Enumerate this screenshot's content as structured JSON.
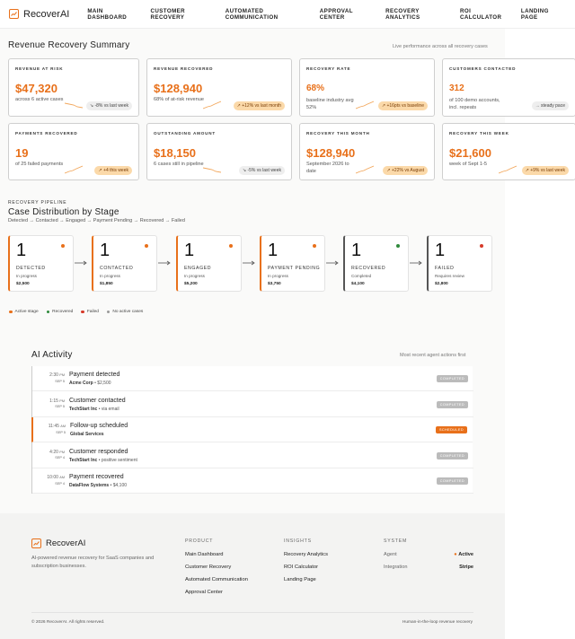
{
  "nav": {
    "brand": "RecoverAI",
    "links": [
      "MAIN DASHBOARD",
      "CUSTOMER RECOVERY",
      "AUTOMATED COMMUNICATION",
      "APPROVAL CENTER",
      "RECOVERY ANALYTICS",
      "ROI CALCULATOR",
      "LANDING PAGE"
    ]
  },
  "summary": {
    "title": "Revenue Recovery Summary",
    "note": "Live performance across all recovery cases",
    "cards": [
      {
        "label": "REVENUE AT RISK",
        "value": "$47,320",
        "desc": "across 6 active cases",
        "trend": "↘ -8% vs last week",
        "trend_dir": "down"
      },
      {
        "label": "REVENUE RECOVERED",
        "value": "$128,940",
        "desc": "68% of at-risk revenue",
        "trend": "↗ +12% vs last month",
        "trend_dir": "up"
      },
      {
        "label": "RECOVERY RATE",
        "value": "68%",
        "desc": "baseline industry avg 52%",
        "trend": "↗ +16pts vs baseline",
        "trend_dir": "up"
      },
      {
        "label": "CUSTOMERS CONTACTED",
        "value": "312",
        "desc": "of 100 demo accounts, incl. repeats",
        "trend": "→ steady pace",
        "trend_dir": "flat"
      },
      {
        "label": "PAYMENTS RECOVERED",
        "value": "19",
        "desc": "of 25 failed payments",
        "trend": "↗ +4 this week",
        "trend_dir": "up"
      },
      {
        "label": "OUTSTANDING AMOUNT",
        "value": "$18,150",
        "desc": "6 cases still in pipeline",
        "trend": "↘ -5% vs last week",
        "trend_dir": "down"
      },
      {
        "label": "RECOVERY THIS MONTH",
        "value": "$128,940",
        "desc": "September 2026 to date",
        "trend": "↗ +22% vs August",
        "trend_dir": "up"
      },
      {
        "label": "RECOVERY THIS WEEK",
        "value": "$21,600",
        "desc": "week of Sept 1-5",
        "trend": "↗ +9% vs last week",
        "trend_dir": "up"
      }
    ]
  },
  "pipeline": {
    "eyebrow": "RECOVERY PIPELINE",
    "title": "Case Distribution by Stage",
    "flow": "Detected → Contacted → Engaged → Payment Pending → Recovered → Failed",
    "stages": [
      {
        "count": "1",
        "name": "DETECTED",
        "status": "In progress",
        "amount": "$2,500",
        "dot": "#e8701a"
      },
      {
        "count": "1",
        "name": "CONTACTED",
        "status": "In progress",
        "amount": "$1,850",
        "dot": "#e8701a"
      },
      {
        "count": "1",
        "name": "ENGAGED",
        "status": "In progress",
        "amount": "$5,200",
        "dot": "#e8701a"
      },
      {
        "count": "1",
        "name": "PAYMENT PENDING",
        "status": "In progress",
        "amount": "$3,750",
        "dot": "#e8701a"
      },
      {
        "count": "1",
        "name": "RECOVERED",
        "status": "Completed",
        "amount": "$4,100",
        "dot": "#2f8a3c"
      },
      {
        "count": "1",
        "name": "FAILED",
        "status": "Requires review",
        "amount": "$2,800",
        "dot": "#d63a2a"
      }
    ],
    "legend": [
      {
        "label": "Active stage",
        "color": "#e8701a"
      },
      {
        "label": "Recovered",
        "color": "#2f8a3c"
      },
      {
        "label": "Failed",
        "color": "#d63a2a"
      },
      {
        "label": "No active cases",
        "color": "#999999"
      }
    ]
  },
  "activity": {
    "title": "AI Activity",
    "note": "Most recent agent actions first",
    "rows": [
      {
        "time": "2:30",
        "ampm": "PM",
        "date": "SEP 5",
        "title": "Payment detected",
        "company": "Acme Corp",
        "detail": "$2,500",
        "badge": "COMPLETED"
      },
      {
        "time": "1:15",
        "ampm": "PM",
        "date": "SEP 5",
        "title": "Customer contacted",
        "company": "TechStart Inc",
        "detail": "via email",
        "badge": "COMPLETED"
      },
      {
        "time": "11:45",
        "ampm": "AM",
        "date": "SEP 5",
        "title": "Follow-up scheduled",
        "company": "Global Services",
        "detail": "",
        "badge": "SCHEDULED"
      },
      {
        "time": "4:20",
        "ampm": "PM",
        "date": "SEP 4",
        "title": "Customer responded",
        "company": "TechStart Inc",
        "detail": "positive sentiment",
        "badge": "COMPLETED"
      },
      {
        "time": "10:00",
        "ampm": "AM",
        "date": "SEP 4",
        "title": "Payment recovered",
        "company": "DataFlow Systems",
        "detail": "$4,100",
        "badge": "COMPLETED"
      }
    ]
  },
  "footer": {
    "brand": "RecoverAI",
    "desc": "AI-powered revenue recovery for SaaS companies and subscription businesses.",
    "product_head": "PRODUCT",
    "product_links": [
      "Main Dashboard",
      "Customer Recovery",
      "Automated Communication",
      "Approval Center"
    ],
    "insights_head": "INSIGHTS",
    "insights_links": [
      "Recovery Analytics",
      "ROI Calculator",
      "Landing Page"
    ],
    "system_head": "SYSTEM",
    "agent_label": "Agent",
    "agent_value": "Active",
    "integration_label": "Integration",
    "integration_value": "Stripe",
    "copyright": "© 2026 RecoverAI. All rights reserved.",
    "tagline": "Human-in-the-loop revenue recovery"
  },
  "colors": {
    "accent": "#e8701a",
    "success": "#2f8a3c",
    "danger": "#d63a2a"
  }
}
